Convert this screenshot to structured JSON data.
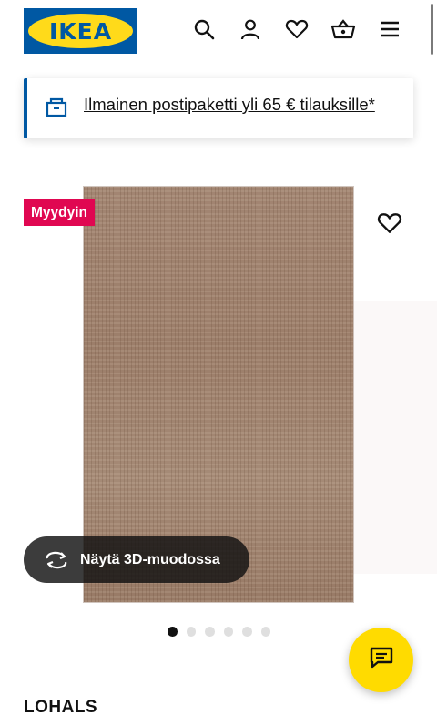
{
  "header": {
    "logo_text": "IKEA",
    "icons": [
      "search-icon",
      "account-icon",
      "heart-icon",
      "shopping-basket-icon",
      "menu-icon"
    ]
  },
  "banner": {
    "text": "Ilmainen postipaketti yli 65 € tilauksille*",
    "icon": "delivery-box-icon",
    "accent": "#0058a3"
  },
  "product": {
    "badge": "Myydyin",
    "badge_color": "#e00751",
    "view_3d_label": "Näytä 3D-muodossa",
    "image_count": 6,
    "active_image_index": 0,
    "name": "LOHALS"
  },
  "chat": {
    "icon": "chat-icon",
    "color": "#ffdb00"
  },
  "colors": {
    "brand_blue": "#0058a3",
    "brand_yellow": "#ffda1a"
  }
}
